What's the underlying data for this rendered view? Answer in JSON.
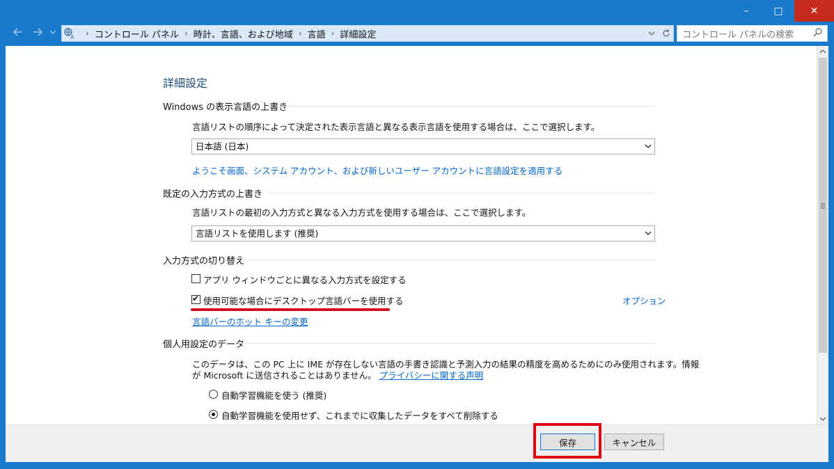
{
  "window": {
    "minimize_glyph": "–",
    "maximize_glyph": "□",
    "close_glyph": "✕"
  },
  "nav": {
    "back_icon": "arrow-left-icon",
    "forward_icon": "arrow-right-icon",
    "recent_icon": "chevron-down-icon",
    "up_icon": "arrow-up-icon"
  },
  "breadcrumb": {
    "items": [
      "コントロール パネル",
      "時計、言語、および地域",
      "言語",
      "詳細設定"
    ],
    "separator": "›"
  },
  "search": {
    "placeholder": "コントロール パネルの検索"
  },
  "page": {
    "title": "詳細設定",
    "display_language": {
      "header": "Windows の表示言語の上書き",
      "description": "言語リストの順序によって決定された表示言語と異なる表示言語を使用する場合は、ここで選択します。",
      "selected": "日本語 (日本)",
      "link": "ようこそ画面、システム アカウント、および新しいユーザー アカウントに言語設定を適用する"
    },
    "input_method": {
      "header": "既定の入力方式の上書き",
      "description": "言語リストの最初の入力方式と異なる入力方式を使用する場合は、ここで選択します。",
      "selected": "言語リストを使用します (推奨)"
    },
    "switching": {
      "header": "入力方式の切り替え",
      "per_app_label": "アプリ ウィンドウごとに異なる入力方式を設定する",
      "per_app_checked": false,
      "langbar_label": "使用可能な場合にデスクトップ言語バーを使用する",
      "langbar_checked": true,
      "options_link": "オプション",
      "hotkey_link": "言語バーのホット キーの変更"
    },
    "personal_data": {
      "header": "個人用設定のデータ",
      "description_line1": "このデータは、この PC 上に IME が存在しない言語の手書き認識と予測入力の結果の精度を高めるためにのみ使用されます。情報",
      "description_line2": "が Microsoft に送信されることはありません。",
      "privacy_link": "プライバシーに関する声明",
      "option_learn": "自動学習機能を使う (推奨)",
      "option_no_learn": "自動学習機能を使用せず、これまでに収集したデータをすべて削除する",
      "selected_option": "no_learn"
    }
  },
  "footer": {
    "save_label": "保存",
    "cancel_label": "キャンセル"
  },
  "colors": {
    "titlebar": "#1979ca",
    "link": "#0066cc",
    "highlight": "#e00010"
  }
}
